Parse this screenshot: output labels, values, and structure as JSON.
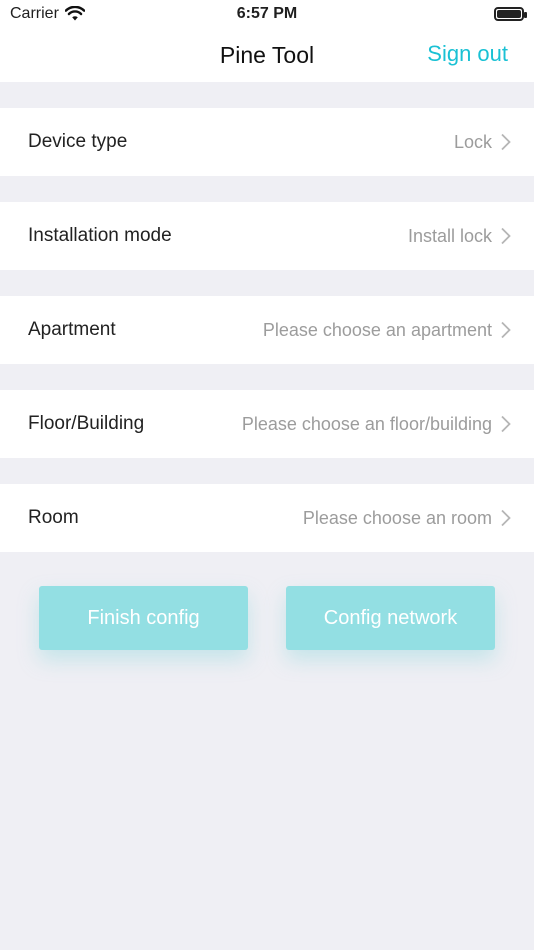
{
  "status_bar": {
    "carrier": "Carrier",
    "time": "6:57 PM",
    "icons": [
      "wifi-icon",
      "battery-icon"
    ]
  },
  "nav": {
    "title": "Pine Tool",
    "sign_out": "Sign out",
    "accent_color": "#1ac1d4"
  },
  "rows": [
    {
      "label": "Device type",
      "value": "Lock"
    },
    {
      "label": "Installation mode",
      "value": "Install lock"
    },
    {
      "label": "Apartment",
      "value": "Please choose an apartment"
    },
    {
      "label": "Floor/Building",
      "value": "Please choose an floor/building"
    },
    {
      "label": "Room",
      "value": "Please choose an room"
    }
  ],
  "buttons": {
    "finish": "Finish config",
    "network": "Config network",
    "color": "#93dfe3"
  }
}
